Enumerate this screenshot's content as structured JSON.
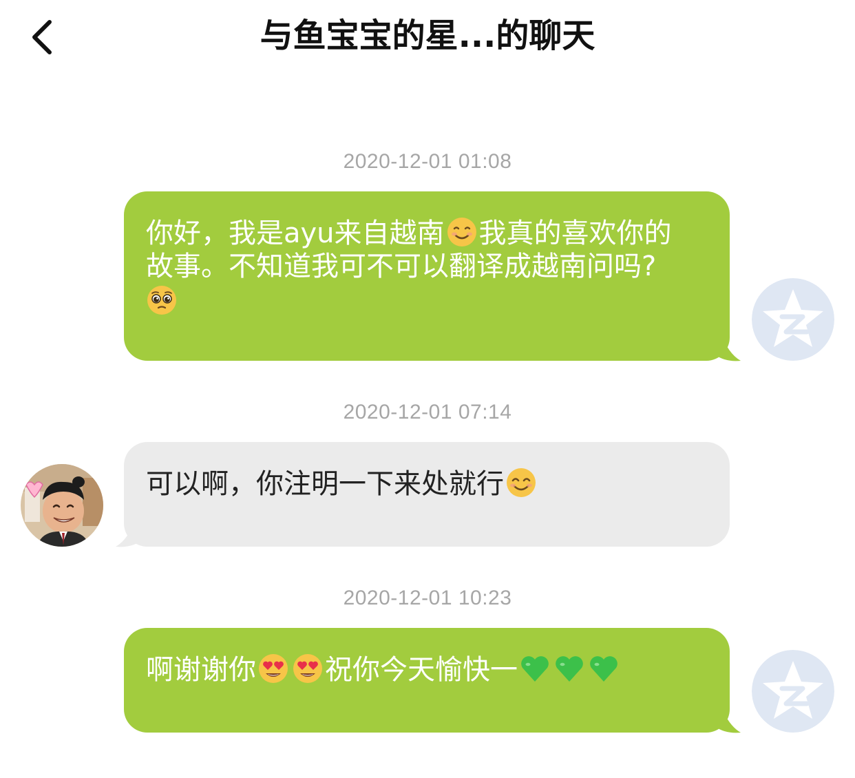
{
  "header": {
    "title": "与鱼宝宝的星...的聊天"
  },
  "messages": [
    {
      "timestamp": "2020-12-01 01:08",
      "direction": "out",
      "line1": "你好，我是ayu来自越南",
      "line1b": "我真的喜欢你的",
      "line2": "故事。不知道我可不可以翻译成越南问吗?",
      "emojis": [
        "smiling-face-emoji",
        "pleading-face-emoji"
      ]
    },
    {
      "timestamp": "2020-12-01 07:14",
      "direction": "in",
      "text": "可以啊，你注明一下来处就行",
      "emojis": [
        "smiling-face-with-smiling-eyes-emoji"
      ]
    },
    {
      "timestamp": "2020-12-01 10:23",
      "direction": "out",
      "text_a": "啊谢谢你",
      "text_b": "祝你今天愉快一",
      "emojis": [
        "heart-eyes-emoji",
        "heart-eyes-emoji",
        "green-heart-emoji",
        "green-heart-emoji",
        "green-heart-emoji"
      ]
    }
  ],
  "colors": {
    "outgoing_bubble": "#a2cc3e",
    "incoming_bubble": "#ebebeb",
    "timestamp": "#a6a6a6",
    "qzone_avatar": "#dfe7f3"
  },
  "icons": {
    "back": "chevron-left-icon",
    "self_avatar": "qzone-star-avatar",
    "contact_avatar": "contact-photo-avatar"
  }
}
